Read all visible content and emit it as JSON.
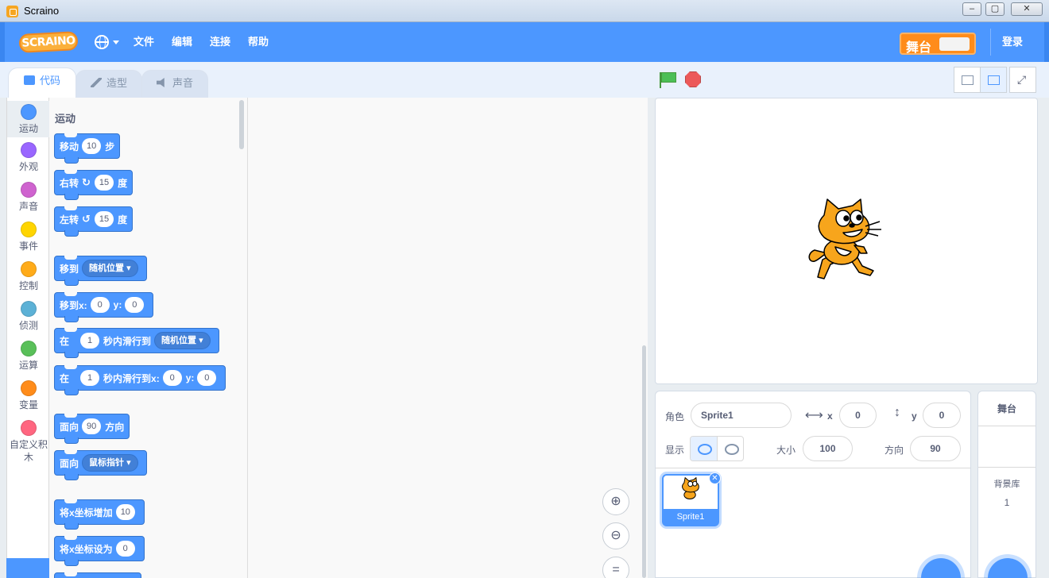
{
  "window": {
    "title": "Scraino"
  },
  "menubar": {
    "logo": "SCRAINO",
    "items": [
      "文件",
      "编辑",
      "连接",
      "帮助"
    ],
    "stage_label": "舞台",
    "login": "登录"
  },
  "tabs": [
    "代码",
    "造型",
    "声音"
  ],
  "categories": [
    {
      "label": "运动",
      "color": "#4c97ff"
    },
    {
      "label": "外观",
      "color": "#9966ff"
    },
    {
      "label": "声音",
      "color": "#cf63cf"
    },
    {
      "label": "事件",
      "color": "#ffd500"
    },
    {
      "label": "控制",
      "color": "#ffab19"
    },
    {
      "label": "侦测",
      "color": "#5cb1d6"
    },
    {
      "label": "运算",
      "color": "#59c059"
    },
    {
      "label": "变量",
      "color": "#ff8c1a"
    },
    {
      "label": "自定义积木",
      "color": "#ff6680"
    }
  ],
  "palette": {
    "heading": "运动",
    "blocks": {
      "move": {
        "a": "移动",
        "v": "10",
        "b": "步"
      },
      "turn_right": {
        "a": "右转",
        "v": "15",
        "b": "度"
      },
      "turn_left": {
        "a": "左转",
        "v": "15",
        "b": "度"
      },
      "goto": {
        "a": "移到",
        "dd": "随机位置"
      },
      "goto_xy": {
        "a": "移到x:",
        "x": "0",
        "y_label": "y:",
        "y": "0"
      },
      "glide": {
        "a": "在",
        "v": "1",
        "b": "秒内滑行到",
        "dd": "随机位置"
      },
      "glide_xy": {
        "a": "在",
        "v": "1",
        "b": "秒内滑行到x:",
        "x": "0",
        "y_label": "y:",
        "y": "0"
      },
      "point_dir": {
        "a": "面向",
        "v": "90",
        "b": "方向"
      },
      "point_towards": {
        "a": "面向",
        "dd": "鼠标指针"
      },
      "change_x": {
        "a": "将x坐标增加",
        "v": "10"
      },
      "set_x": {
        "a": "将x坐标设为",
        "v": "0"
      }
    }
  },
  "sprite_info": {
    "sprite_label": "角色",
    "sprite_name": "Sprite1",
    "x_label": "x",
    "x": "0",
    "y_label": "y",
    "y": "0",
    "show_label": "显示",
    "size_label": "大小",
    "size": "100",
    "direction_label": "方向",
    "direction": "90"
  },
  "sprites": [
    {
      "name": "Sprite1"
    }
  ],
  "stage_pane": {
    "title": "舞台",
    "backdrops_label": "背景库",
    "backdrops_count": "1"
  }
}
